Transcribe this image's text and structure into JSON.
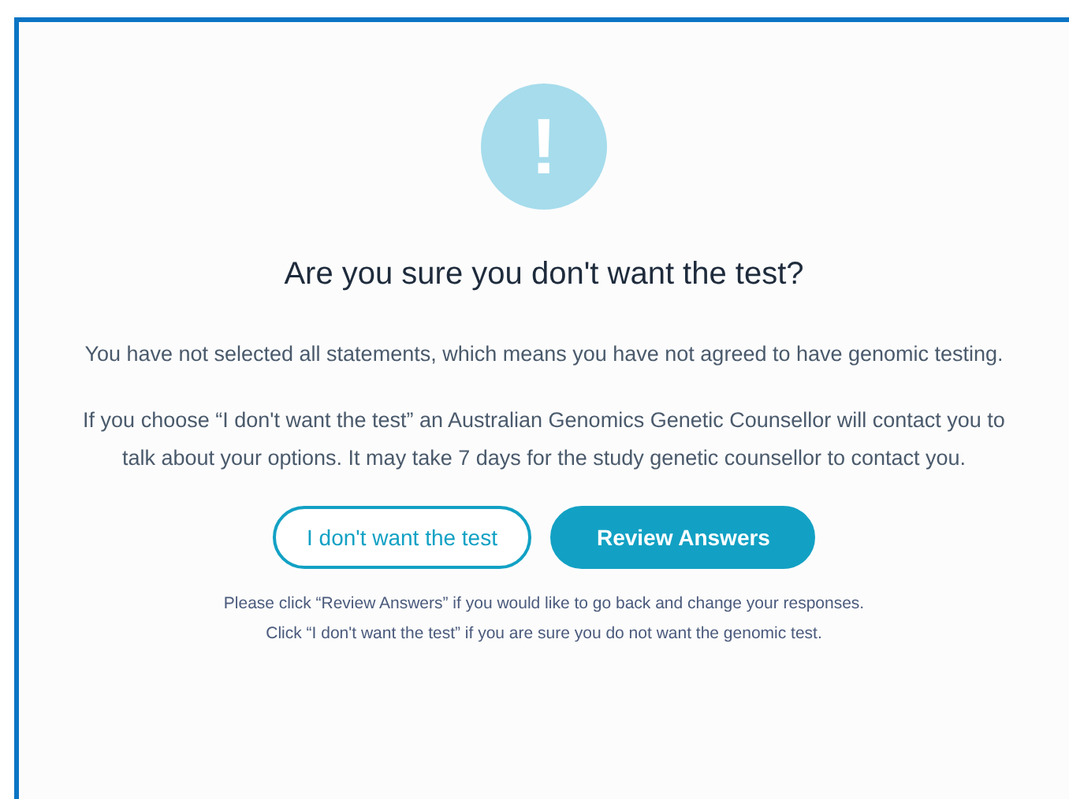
{
  "dialog": {
    "icon_symbol": "!",
    "title": "Are you sure you don't want the test?",
    "paragraphs": [
      "You have not selected all statements, which means you have not agreed to have genomic testing.",
      "If you choose “I don't want the test” an Australian Genomics Genetic Counsellor will contact you to talk about your options. It may take 7 days for the study genetic counsellor to contact you."
    ],
    "buttons": [
      {
        "label": "I don't want the test",
        "kind": "outline"
      },
      {
        "label": "Review Answers",
        "kind": "primary"
      }
    ],
    "notes": [
      "Please click “Review Answers” if you would like to go back and change your responses.",
      "Click “I don't want the test” if you are sure you do not want the genomic test."
    ]
  }
}
